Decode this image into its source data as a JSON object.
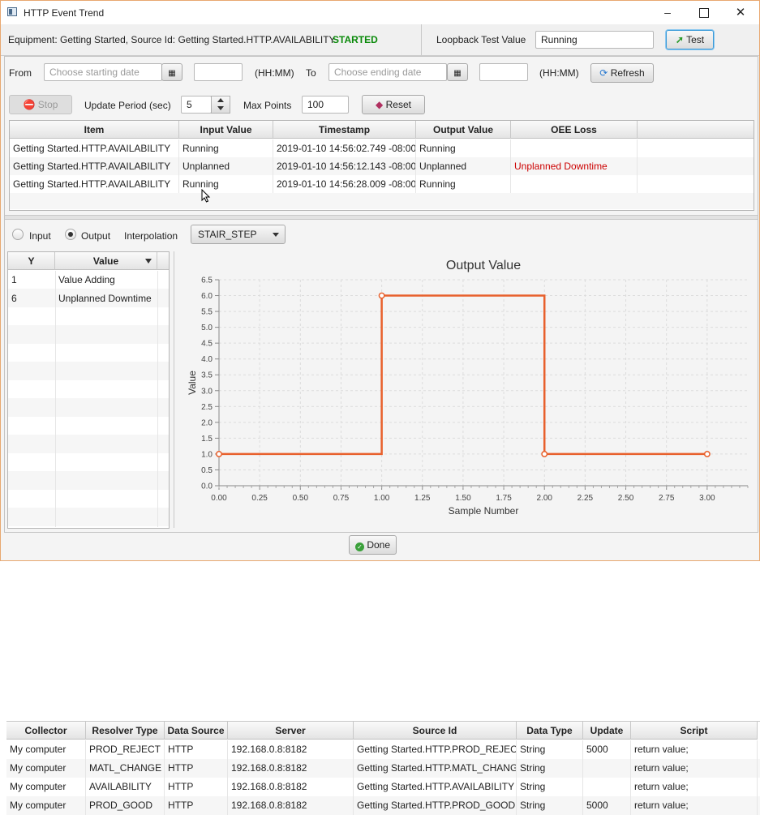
{
  "window": {
    "title": "HTTP Event Trend",
    "controls": [
      "–",
      "☐",
      "✕"
    ]
  },
  "info": {
    "equipment_text": "Equipment: Getting Started, Source Id: Getting Started.HTTP.AVAILABILITY",
    "status": "STARTED",
    "loopback_label": "Loopback Test Value",
    "loopback_value": "Running",
    "test_button": "Test"
  },
  "range": {
    "from_label": "From",
    "from_placeholder": "Choose starting date",
    "hhmm_label": "(HH:MM)",
    "to_label": "To",
    "to_placeholder": "Choose ending date",
    "refresh_button": "Refresh"
  },
  "controls": {
    "stop_button": "Stop",
    "update_period_label": "Update Period (sec)",
    "update_period_value": "5",
    "max_points_label": "Max Points",
    "max_points_value": "100",
    "reset_button": "Reset"
  },
  "events_table": {
    "columns": [
      "Item",
      "Input Value",
      "Timestamp",
      "Output Value",
      "OEE Loss"
    ],
    "rows": [
      [
        "Getting Started.HTTP.AVAILABILITY",
        "Running",
        "2019-01-10 14:56:02.749 -08:00",
        "Running",
        ""
      ],
      [
        "Getting Started.HTTP.AVAILABILITY",
        "Unplanned",
        "2019-01-10 14:56:12.143 -08:00",
        "Unplanned",
        "Unplanned Downtime"
      ],
      [
        "Getting Started.HTTP.AVAILABILITY",
        "Running",
        "2019-01-10 14:56:28.009 -08:00",
        "Running",
        ""
      ]
    ]
  },
  "options": {
    "input_label": "Input",
    "output_label": "Output",
    "interpolation_label": "Interpolation",
    "interpolation_value": "STAIR_STEP"
  },
  "y_table": {
    "columns": [
      "Y",
      "Value"
    ],
    "rows": [
      [
        "1",
        "Value Adding"
      ],
      [
        "6",
        "Unplanned Downtime"
      ]
    ]
  },
  "chart_data": {
    "type": "line",
    "title": "Output Value",
    "xlabel": "Sample Number",
    "ylabel": "Value",
    "x_ticks": [
      "0.00",
      "0.25",
      "0.50",
      "0.75",
      "1.00",
      "1.25",
      "1.50",
      "1.75",
      "2.00",
      "2.25",
      "2.50",
      "2.75",
      "3.00"
    ],
    "y_ticks": [
      "0.0",
      "0.5",
      "1.0",
      "1.5",
      "2.0",
      "2.5",
      "3.0",
      "3.5",
      "4.0",
      "4.5",
      "5.0",
      "5.5",
      "6.0",
      "6.5"
    ],
    "xlim": [
      0,
      3.25
    ],
    "ylim": [
      0,
      6.5
    ],
    "interpolation": "stair-step",
    "grid": true,
    "series": [
      {
        "x": [
          0,
          1,
          2,
          3
        ],
        "y": [
          1,
          6,
          1,
          1
        ],
        "color": "#e8602c"
      }
    ]
  },
  "done_button": "Done",
  "colors": {
    "accent": "#e8602c",
    "started": "#0a8a0a",
    "loss": "#cc0000"
  },
  "collectors_table": {
    "columns": [
      "Collector",
      "Resolver Type",
      "Data Source",
      "Server",
      "Source Id",
      "Data Type",
      "Update",
      "Script"
    ],
    "rows": [
      [
        "My computer",
        "PROD_REJECT",
        "HTTP",
        "192.168.0.8:8182",
        "Getting Started.HTTP.PROD_REJECT",
        "String",
        "5000",
        "return value;"
      ],
      [
        "My computer",
        "MATL_CHANGE",
        "HTTP",
        "192.168.0.8:8182",
        "Getting Started.HTTP.MATL_CHANGE",
        "String",
        "",
        "return value;"
      ],
      [
        "My computer",
        "AVAILABILITY",
        "HTTP",
        "192.168.0.8:8182",
        "Getting Started.HTTP.AVAILABILITY",
        "String",
        "",
        "return value;"
      ],
      [
        "My computer",
        "PROD_GOOD",
        "HTTP",
        "192.168.0.8:8182",
        "Getting Started.HTTP.PROD_GOOD",
        "String",
        "5000",
        "return value;"
      ]
    ]
  }
}
